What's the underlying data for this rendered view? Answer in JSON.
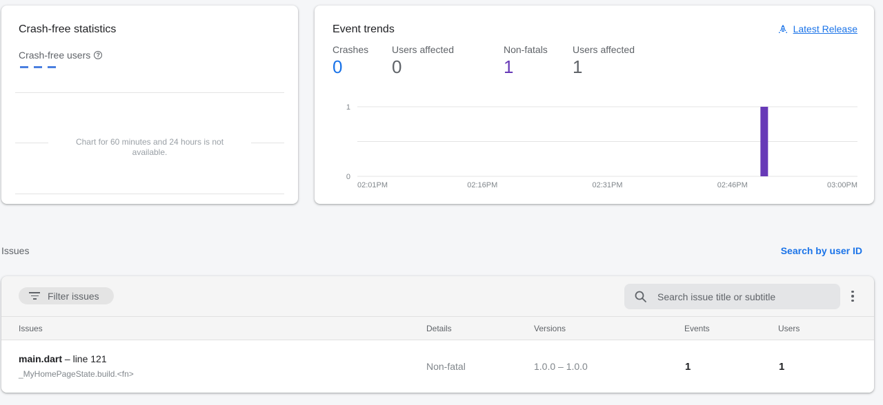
{
  "crash_free": {
    "title": "Crash-free statistics",
    "metric_label": "Crash-free users",
    "help_icon": "question-circle-icon",
    "value_placeholder": "- - -",
    "chart_message": "Chart for 60 minutes and 24 hours is not available."
  },
  "event_trends": {
    "title": "Event trends",
    "release_link": "Latest Release",
    "release_icon": "rocket-icon",
    "stats": [
      {
        "label": "Crashes",
        "value": "0",
        "color": "#1a73e8"
      },
      {
        "label": "Users affected",
        "value": "0",
        "color": "#5f6368"
      },
      {
        "label": "Non-fatals",
        "value": "1",
        "color": "#673ab7"
      },
      {
        "label": "Users affected",
        "value": "1",
        "color": "#5f6368"
      }
    ]
  },
  "chart_data": {
    "type": "bar",
    "title": "Event trends",
    "xlabel": "",
    "ylabel": "",
    "ylim": [
      0,
      1
    ],
    "y_ticks": [
      "0",
      "1"
    ],
    "x_ticks": [
      "02:01PM",
      "02:16PM",
      "02:31PM",
      "02:46PM",
      "03:00PM"
    ],
    "x_range_minutes": [
      0,
      59
    ],
    "series": [
      {
        "name": "Non-fatals",
        "color": "#673ab7",
        "points": [
          {
            "time": "02:49PM",
            "minute_offset": 48,
            "value": 1
          }
        ]
      },
      {
        "name": "Crashes",
        "color": "#1a73e8",
        "points": []
      }
    ],
    "grid": true
  },
  "issues_section": {
    "label": "Issues",
    "search_by_user_link": "Search by user ID",
    "filter_label": "Filter issues",
    "search_placeholder": "Search issue title or subtitle",
    "columns": [
      "Issues",
      "Details",
      "Versions",
      "Events",
      "Users"
    ],
    "rows": [
      {
        "file": "main.dart",
        "line_text": " – line 121",
        "subtitle": "_MyHomePageState.build.<fn>",
        "details": "Non-fatal",
        "versions": "1.0.0 – 1.0.0",
        "events": "1",
        "users": "1"
      }
    ]
  }
}
